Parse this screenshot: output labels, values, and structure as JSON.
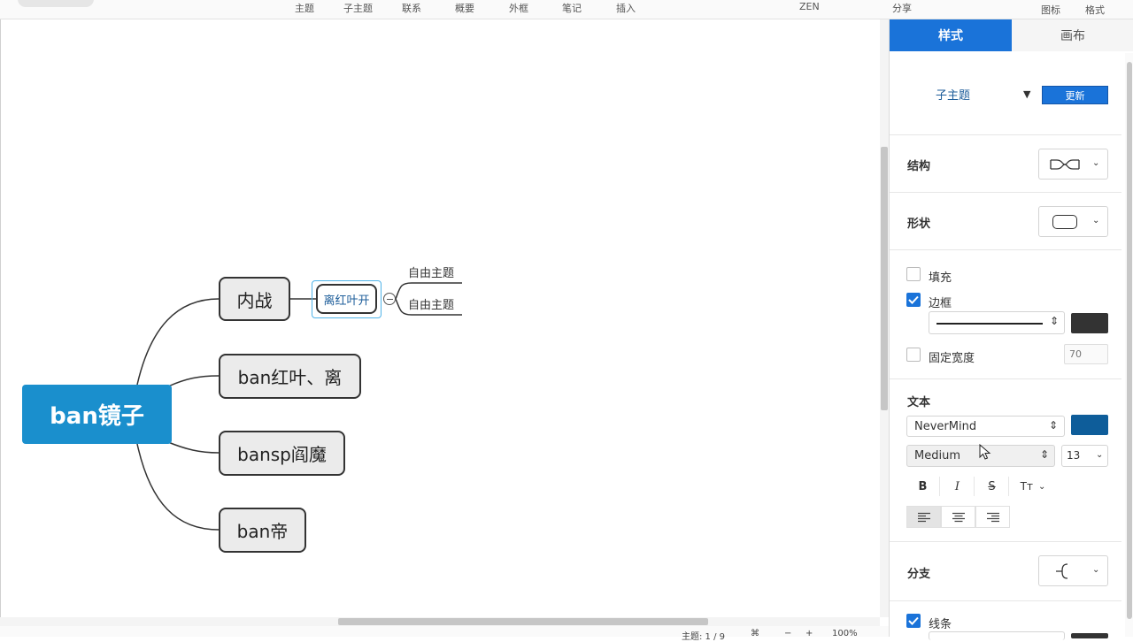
{
  "toolbar": {
    "items": [
      "主题",
      "子主题",
      "联系",
      "概要",
      "外框",
      "笔记",
      "插入"
    ],
    "zen": "ZEN",
    "share": "分享",
    "icon": "图标",
    "format": "格式"
  },
  "mindmap": {
    "central": "ban镜子",
    "branches": [
      "内战",
      "ban红叶、离",
      "bansp阎魔",
      "ban帝"
    ],
    "subtopic": "离红叶开",
    "free_topics": [
      "自由主题",
      "自由主题"
    ]
  },
  "status": {
    "topic_count": "主题: 1 / 9",
    "zoom": "100%"
  },
  "panel": {
    "tabs": [
      "样式",
      "画布"
    ],
    "style_name": "子主题",
    "update_button": "更新",
    "structure_label": "结构",
    "shape_label": "形状",
    "fill_label": "填充",
    "border_label": "边框",
    "fixed_width_label": "固定宽度",
    "fixed_width_placeholder": "70",
    "text_label": "文本",
    "font_family": "NeverMind",
    "font_weight": "Medium",
    "font_size": "13",
    "branch_label": "分支",
    "line_label": "线条",
    "format_buttons": [
      "B",
      "I",
      "S",
      "Tт"
    ],
    "fill_checked": false,
    "border_checked": true,
    "fixed_width_checked": false,
    "line_checked": true
  },
  "colors": {
    "accent": "#1a73d9",
    "central_fill": "#1a8fcd",
    "border_color": "#333333",
    "text_color": "#0e5d9a",
    "selection": "#4fb3e8"
  },
  "icons": [
    "structure-icon",
    "shape-icon",
    "branch-icon",
    "align-left-icon",
    "align-center-icon",
    "align-right-icon",
    "collapse-icon",
    "cursor-icon"
  ]
}
